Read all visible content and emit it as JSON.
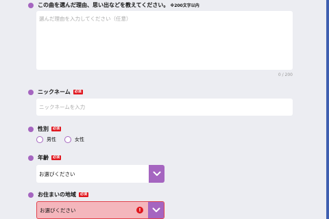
{
  "reason": {
    "label": "この曲を選んだ理由、思い出などを教えてください。",
    "note": "※200文字以内",
    "placeholder": "選んだ理由を入力してください（任意）",
    "counter": "0 / 200"
  },
  "nickname": {
    "label": "ニックネーム",
    "required_badge": "必須",
    "placeholder": "ニックネームを入力"
  },
  "gender": {
    "label": "性別",
    "required_badge": "必須",
    "options": [
      "男性",
      "女性"
    ]
  },
  "age": {
    "label": "年齢",
    "required_badge": "必須",
    "selected": "お選びください"
  },
  "region": {
    "label": "お住まいの地域",
    "required_badge": "必須",
    "selected": "お選びください",
    "error_icon": "!"
  },
  "colors": {
    "accent": "#a565c0",
    "required": "#e0161e",
    "error_bg": "#f4b6bc",
    "background": "#ecedf2"
  }
}
